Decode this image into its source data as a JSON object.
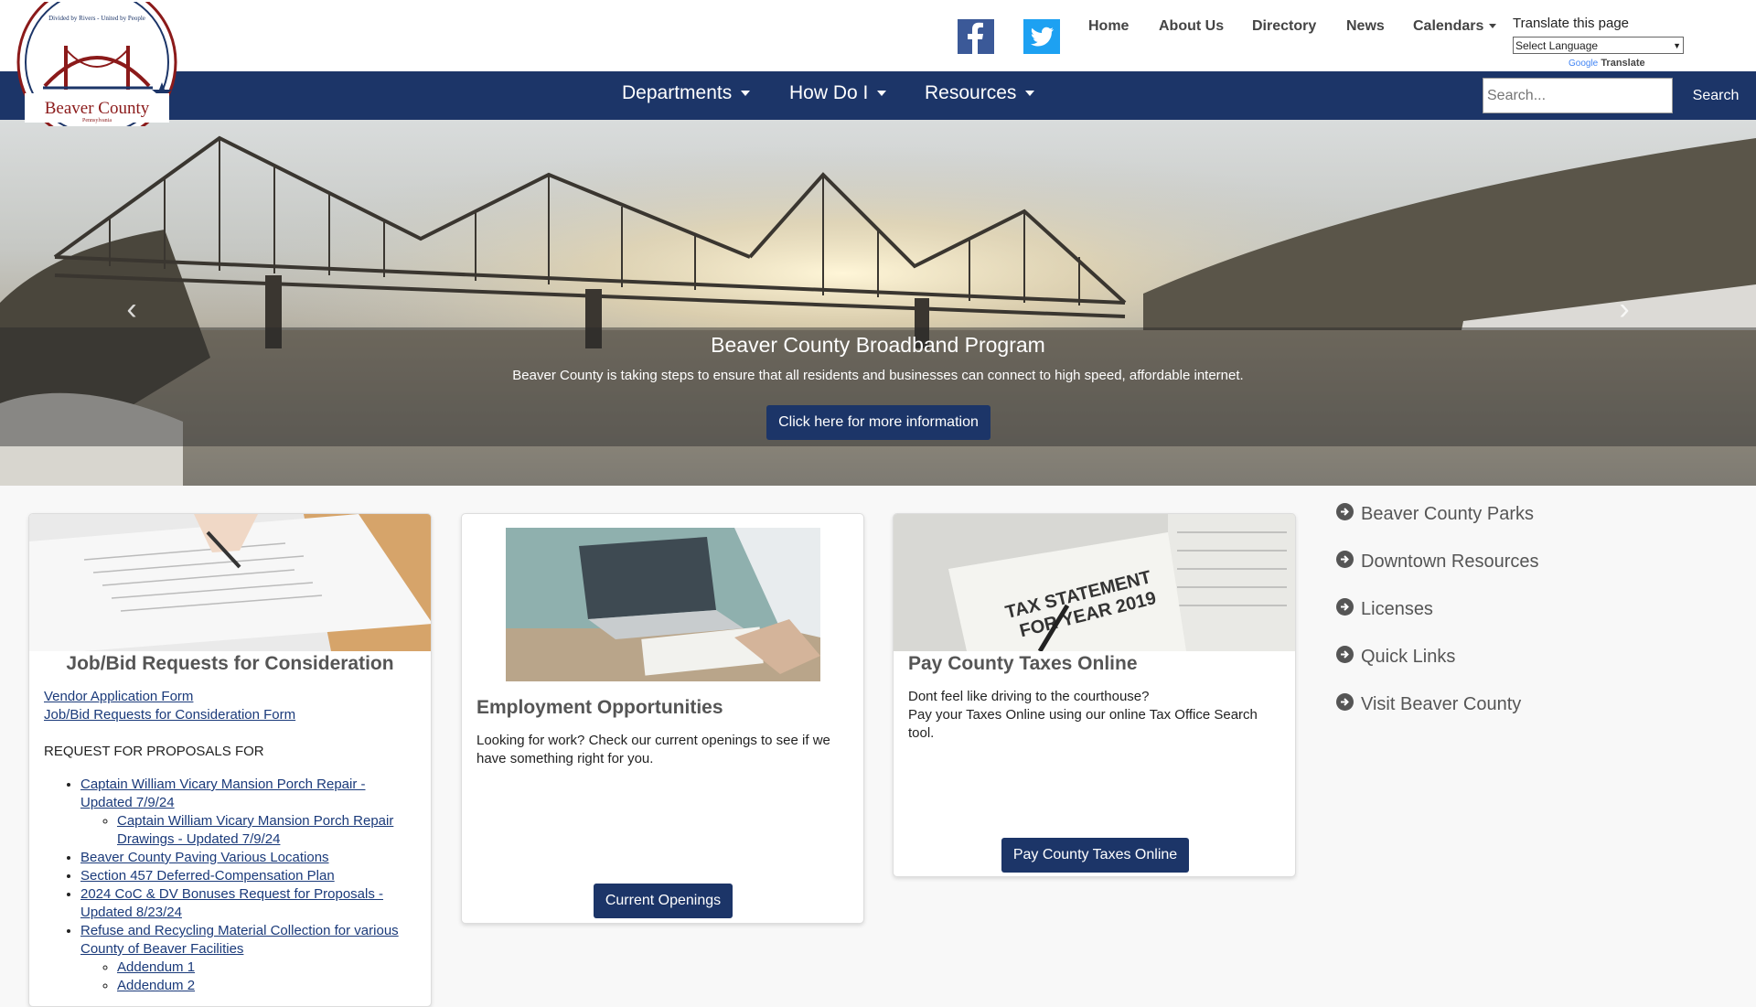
{
  "header": {
    "logo_text": "Beaver County",
    "logo_motto": "Divided by Rivers - United by People",
    "logo_state": "Pennsylvania",
    "social": [
      "facebook-icon",
      "twitter-icon"
    ],
    "links": {
      "home": "Home",
      "about": "About Us",
      "directory": "Directory",
      "news": "News",
      "calendars": "Calendars"
    },
    "translate": {
      "label": "Translate this page",
      "select_value": "Select Language",
      "powered_google": "Google",
      "powered_translate": "Translate"
    }
  },
  "nav": {
    "items": [
      "Departments",
      "How Do I",
      "Resources"
    ],
    "search_placeholder": "Search...",
    "search_button": "Search"
  },
  "hero": {
    "title": "Beaver County Broadband Program",
    "text": "Beaver County is taking steps to ensure that all residents and businesses can connect to high speed, affordable internet.",
    "button": "Click here for more information"
  },
  "cards": {
    "bids": {
      "title": "Job/Bid Requests for Consideration",
      "link_vendor": "Vendor Application Form",
      "link_jobbid": "Job/Bid Requests for Consideration Form",
      "rfp_heading": "REQUEST FOR PROPOSALS FOR",
      "items": {
        "mansion": "Captain William Vicary Mansion Porch Repair - Updated 7/9/24",
        "mansion_drawings": "Captain William Vicary Mansion Porch Repair Drawings - Updated 7/9/24",
        "paving": "Beaver County Paving Various Locations",
        "section457": "Section 457 Deferred-Compensation Plan",
        "coc": "2024 CoC & DV Bonuses Request for Proposals - Updated 8/23/24",
        "refuse": "Refuse and Recycling Material Collection for various County of Beaver Facilities",
        "addendum1": "Addendum 1",
        "addendum2": "Addendum 2"
      }
    },
    "employment": {
      "title": "Employment Opportunities",
      "text": "Looking for work?  Check our current openings to see if we have something right for you.",
      "button": "Current Openings"
    },
    "taxes": {
      "title": "Pay County Taxes Online",
      "line1": "Dont feel like driving to the courthouse?",
      "line2": "Pay your Taxes Online using our online Tax Office Search tool.",
      "button": "Pay County Taxes Online",
      "img_text1": "TAX STATEMENT",
      "img_text2": "FOR YEAR 2019"
    }
  },
  "quick_links": [
    "Beaver County Parks",
    "Downtown Resources",
    "Licenses",
    "Quick Links",
    "Visit Beaver County"
  ],
  "colors": {
    "navy": "#1c3568",
    "link": "#1a3a7a"
  }
}
